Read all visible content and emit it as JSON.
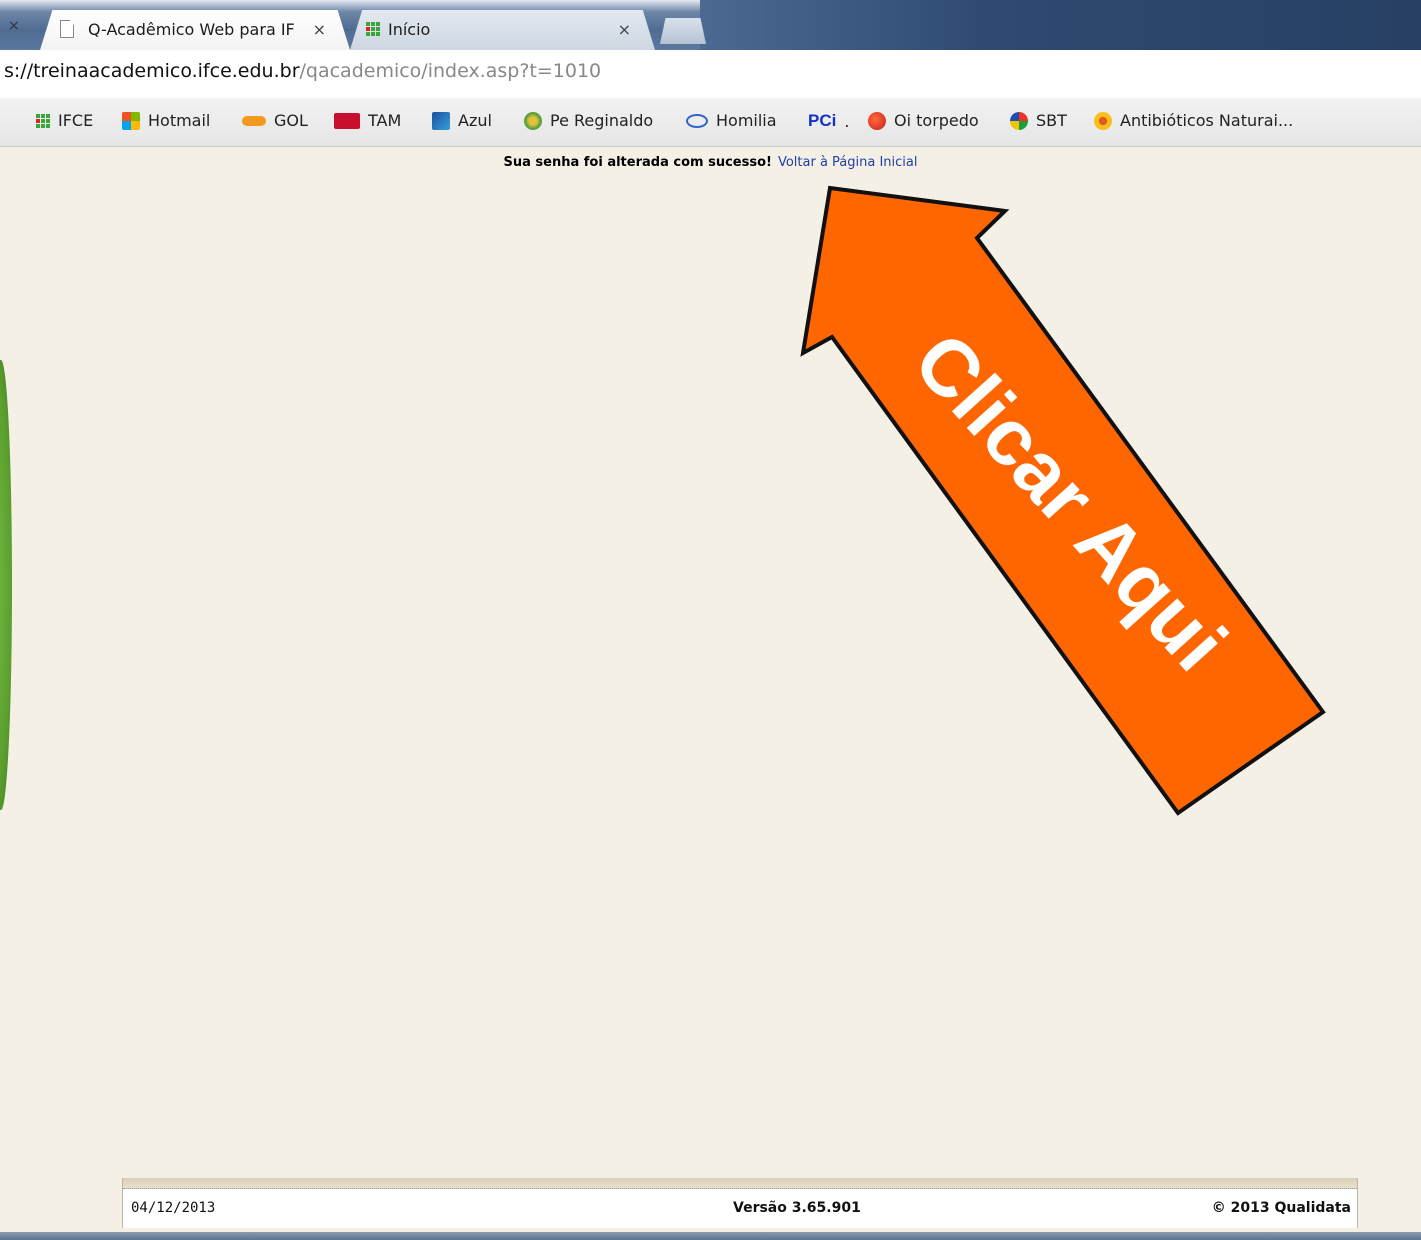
{
  "browser": {
    "tabs": [
      {
        "label": "Q-Acadêmico Web para IF",
        "active": true,
        "icon": "page-icon"
      },
      {
        "label": "Início",
        "active": false,
        "icon": "ifce-grid-icon"
      }
    ],
    "close_glyph": "×",
    "url": {
      "prefix": "s://",
      "host": "treinaacademico.ifce.edu.br",
      "path": "/qacademico/index.asp?t=1010"
    },
    "bookmarks": [
      {
        "label": "IFCE",
        "icon": "ifce-grid-icon"
      },
      {
        "label": "Hotmail",
        "icon": "windows-logo-icon"
      },
      {
        "label": "GOL",
        "icon": "gol-logo-icon"
      },
      {
        "label": "TAM",
        "icon": "tam-logo-icon"
      },
      {
        "label": "Azul",
        "icon": "azul-logo-icon"
      },
      {
        "label": "Pe Reginaldo",
        "icon": "reginaldo-icon"
      },
      {
        "label": "Homilia",
        "icon": "homilia-icon"
      },
      {
        "label": ".",
        "icon": "pci-logo-icon",
        "icon_text": "PCi"
      },
      {
        "label": "Oi torpedo",
        "icon": "oi-logo-icon"
      },
      {
        "label": "SBT",
        "icon": "sbt-logo-icon"
      },
      {
        "label": "Antibióticos Naturai...",
        "icon": "flower-icon"
      }
    ]
  },
  "page": {
    "success_message": "Sua senha foi alterada com sucesso!",
    "return_link": "Voltar à Página Inicial"
  },
  "annotation": {
    "arrow_text": "Clicar Aqui",
    "arrow_color": "#ff6600"
  },
  "footer": {
    "date": "04/12/2013",
    "version": "Versão 3.65.901",
    "copyright": "© 2013 Qualidata"
  }
}
